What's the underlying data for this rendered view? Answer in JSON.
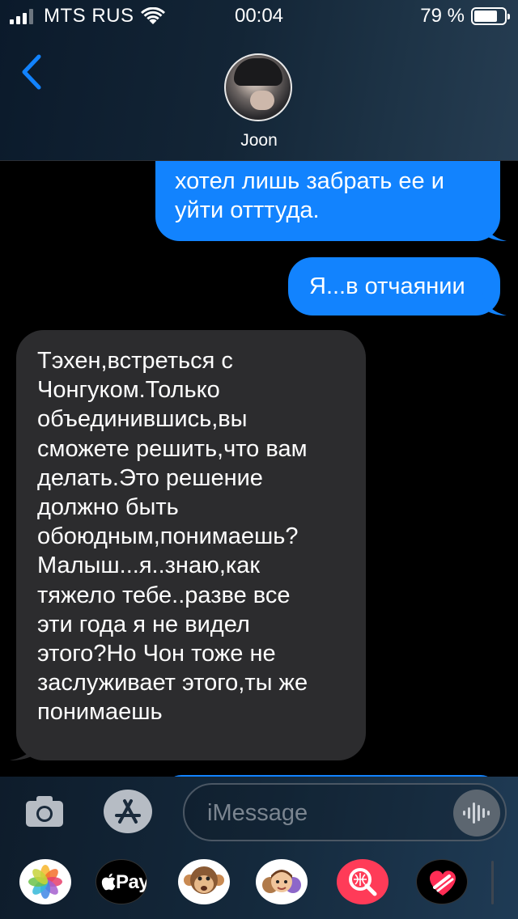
{
  "status_bar": {
    "carrier": "MTS RUS",
    "time": "00:04",
    "battery_percent": "79 %",
    "battery_level": 0.79,
    "signal_bars": 3
  },
  "header": {
    "contact_name": "Joon",
    "back_icon": "chevron-left-icon"
  },
  "messages": [
    {
      "direction": "outgoing",
      "lines": [
        "хотел лишь забрать ее и",
        "уйти отттуда."
      ]
    },
    {
      "direction": "outgoing",
      "text": "Я...в отчаянии"
    },
    {
      "direction": "incoming",
      "lines": [
        "Тэхен,встреться с",
        "Чонгуком.Только",
        "объединившись,вы",
        "сможете решить,что вам",
        "делать.Это решение",
        "должно быть",
        "обоюдным,понимаешь?",
        "Малыш...я..знаю,как",
        "тяжело тебе..разве все",
        "эти года я не видел",
        "этого?Но Чон тоже не",
        "заслуживает этого,ты же",
        "понимаешь"
      ]
    }
  ],
  "composer": {
    "placeholder": "iMessage",
    "value": ""
  },
  "app_tray": {
    "apple_pay_label": "Pay",
    "apps": [
      "photos-icon",
      "apple-pay-icon",
      "animoji-icon",
      "memoji-icon",
      "images-search-icon",
      "digital-touch-icon"
    ]
  },
  "colors": {
    "outgoing_bubble": "#1283fe",
    "incoming_bubble": "#2c2c2e",
    "accent": "#1283fe"
  }
}
